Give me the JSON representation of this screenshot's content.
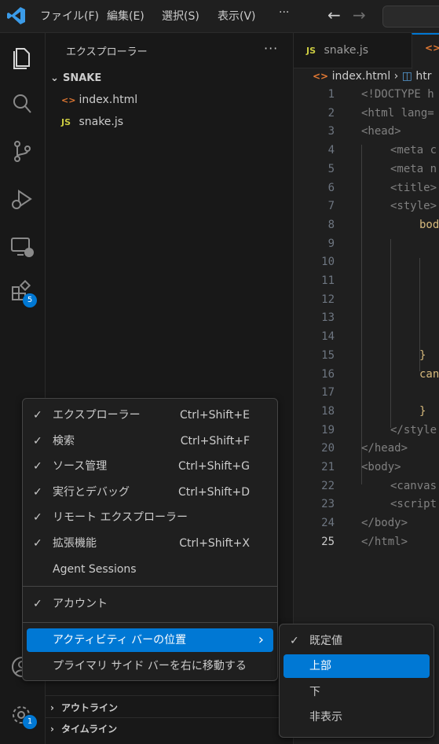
{
  "titlebar": {
    "menus": [
      "ファイル(F)",
      "編集(E)",
      "選択(S)",
      "表示(V)"
    ],
    "more": "···"
  },
  "activitybar": {
    "extensions_badge": "5",
    "settings_badge": "1"
  },
  "sidebar": {
    "title": "エクスプローラー",
    "more": "···",
    "folder": "SNAKE",
    "files": [
      {
        "icon": "<>",
        "name": "index.html"
      },
      {
        "icon": "JS",
        "name": "snake.js"
      }
    ],
    "outline": "アウトライン",
    "timeline": "タイムライン"
  },
  "editor": {
    "tabs": [
      {
        "icon": "JS",
        "name": "snake.js"
      }
    ],
    "breadcrumb": {
      "file": "index.html",
      "next": "htr"
    },
    "lines": [
      {
        "n": "1",
        "t": "<!DOCTYPE h"
      },
      {
        "n": "2",
        "t": "<html lang="
      },
      {
        "n": "3",
        "t": "<head>"
      },
      {
        "n": "4",
        "t": "<meta c"
      },
      {
        "n": "5",
        "t": "<meta n"
      },
      {
        "n": "6",
        "t": "<title>"
      },
      {
        "n": "7",
        "t": "<style>"
      },
      {
        "n": "8",
        "t": "bod"
      },
      {
        "n": "9",
        "t": ""
      },
      {
        "n": "10",
        "t": ""
      },
      {
        "n": "11",
        "t": ""
      },
      {
        "n": "12",
        "t": ""
      },
      {
        "n": "13",
        "t": ""
      },
      {
        "n": "14",
        "t": ""
      },
      {
        "n": "15",
        "t": "}"
      },
      {
        "n": "16",
        "t": "can"
      },
      {
        "n": "17",
        "t": ""
      },
      {
        "n": "18",
        "t": "}"
      },
      {
        "n": "19",
        "t": "</style"
      },
      {
        "n": "20",
        "t": "</head>"
      },
      {
        "n": "21",
        "t": "<body>"
      },
      {
        "n": "22",
        "t": "<canvas"
      },
      {
        "n": "23",
        "t": "<script"
      },
      {
        "n": "24",
        "t": "</body>"
      },
      {
        "n": "25",
        "t": "</html>"
      }
    ]
  },
  "context_menu": {
    "items": [
      {
        "check": "✓",
        "label": "エクスプローラー",
        "key": "Ctrl+Shift+E"
      },
      {
        "check": "✓",
        "label": "検索",
        "key": "Ctrl+Shift+F"
      },
      {
        "check": "✓",
        "label": "ソース管理",
        "key": "Ctrl+Shift+G"
      },
      {
        "check": "✓",
        "label": "実行とデバッグ",
        "key": "Ctrl+Shift+D"
      },
      {
        "check": "✓",
        "label": "リモート エクスプローラー",
        "key": ""
      },
      {
        "check": "✓",
        "label": "拡張機能",
        "key": "Ctrl+Shift+X"
      },
      {
        "check": "",
        "label": "Agent Sessions",
        "key": ""
      }
    ],
    "account": {
      "check": "✓",
      "label": "アカウント"
    },
    "position": {
      "label": "アクティビティ バーの位置",
      "arrow": "›"
    },
    "move": {
      "label": "プライマリ サイド バーを右に移動する"
    }
  },
  "submenu": {
    "items": [
      {
        "check": "✓",
        "label": "既定値"
      },
      {
        "check": "",
        "label": "上部"
      },
      {
        "check": "",
        "label": "下"
      },
      {
        "check": "",
        "label": "非表示"
      }
    ]
  },
  "colors": {
    "accent": "#0078d4",
    "background": "#1f1f1f",
    "js": "#cbcb41",
    "html": "#e37933"
  }
}
